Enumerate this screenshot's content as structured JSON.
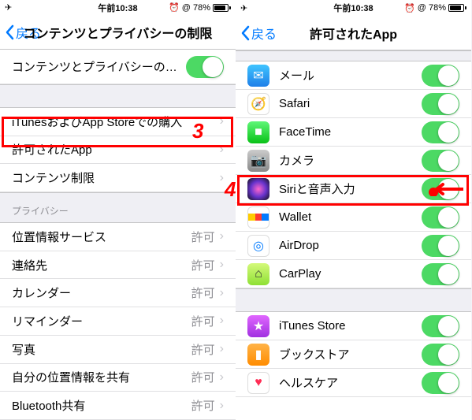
{
  "status": {
    "time": "午前10:38",
    "battery": "78%",
    "alarm": "⏰",
    "orientation": "@"
  },
  "left": {
    "back": "戻る",
    "title": "コンテンツとプライバシーの制限",
    "toggle_label": "コンテンツとプライバシーの制限",
    "itunes": "iTunesおよびApp Storeでの購入",
    "allowed_apps": "許可されたApp",
    "content_limits": "コンテンツ制限",
    "privacy_header": "プライバシー",
    "allow": "許可",
    "location": "位置情報サービス",
    "contacts": "連絡先",
    "calendar": "カレンダー",
    "reminders": "リマインダー",
    "photos": "写真",
    "share_location": "自分の位置情報を共有",
    "bluetooth": "Bluetooth共有"
  },
  "right": {
    "back": "戻る",
    "title": "許可されたApp",
    "mail": "メール",
    "safari": "Safari",
    "facetime": "FaceTime",
    "camera": "カメラ",
    "siri": "Siriと音声入力",
    "wallet": "Wallet",
    "airdrop": "AirDrop",
    "carplay": "CarPlay",
    "itunes_store": "iTunes Store",
    "book_store": "ブックストア",
    "health": "ヘルスケア"
  },
  "callouts": {
    "c3": "3",
    "c4": "4"
  },
  "colors": {
    "mail": "#1f9cf0",
    "safari": "#1f9cf0",
    "facetime": "#4cd964",
    "camera": "#8e8e93",
    "siri": "#2b2b4f",
    "wallet": "#fff",
    "airdrop": "#fff",
    "carplay": "#9fe870",
    "itunes": "#c644fc",
    "books": "#ff9500",
    "health": "#fff"
  }
}
